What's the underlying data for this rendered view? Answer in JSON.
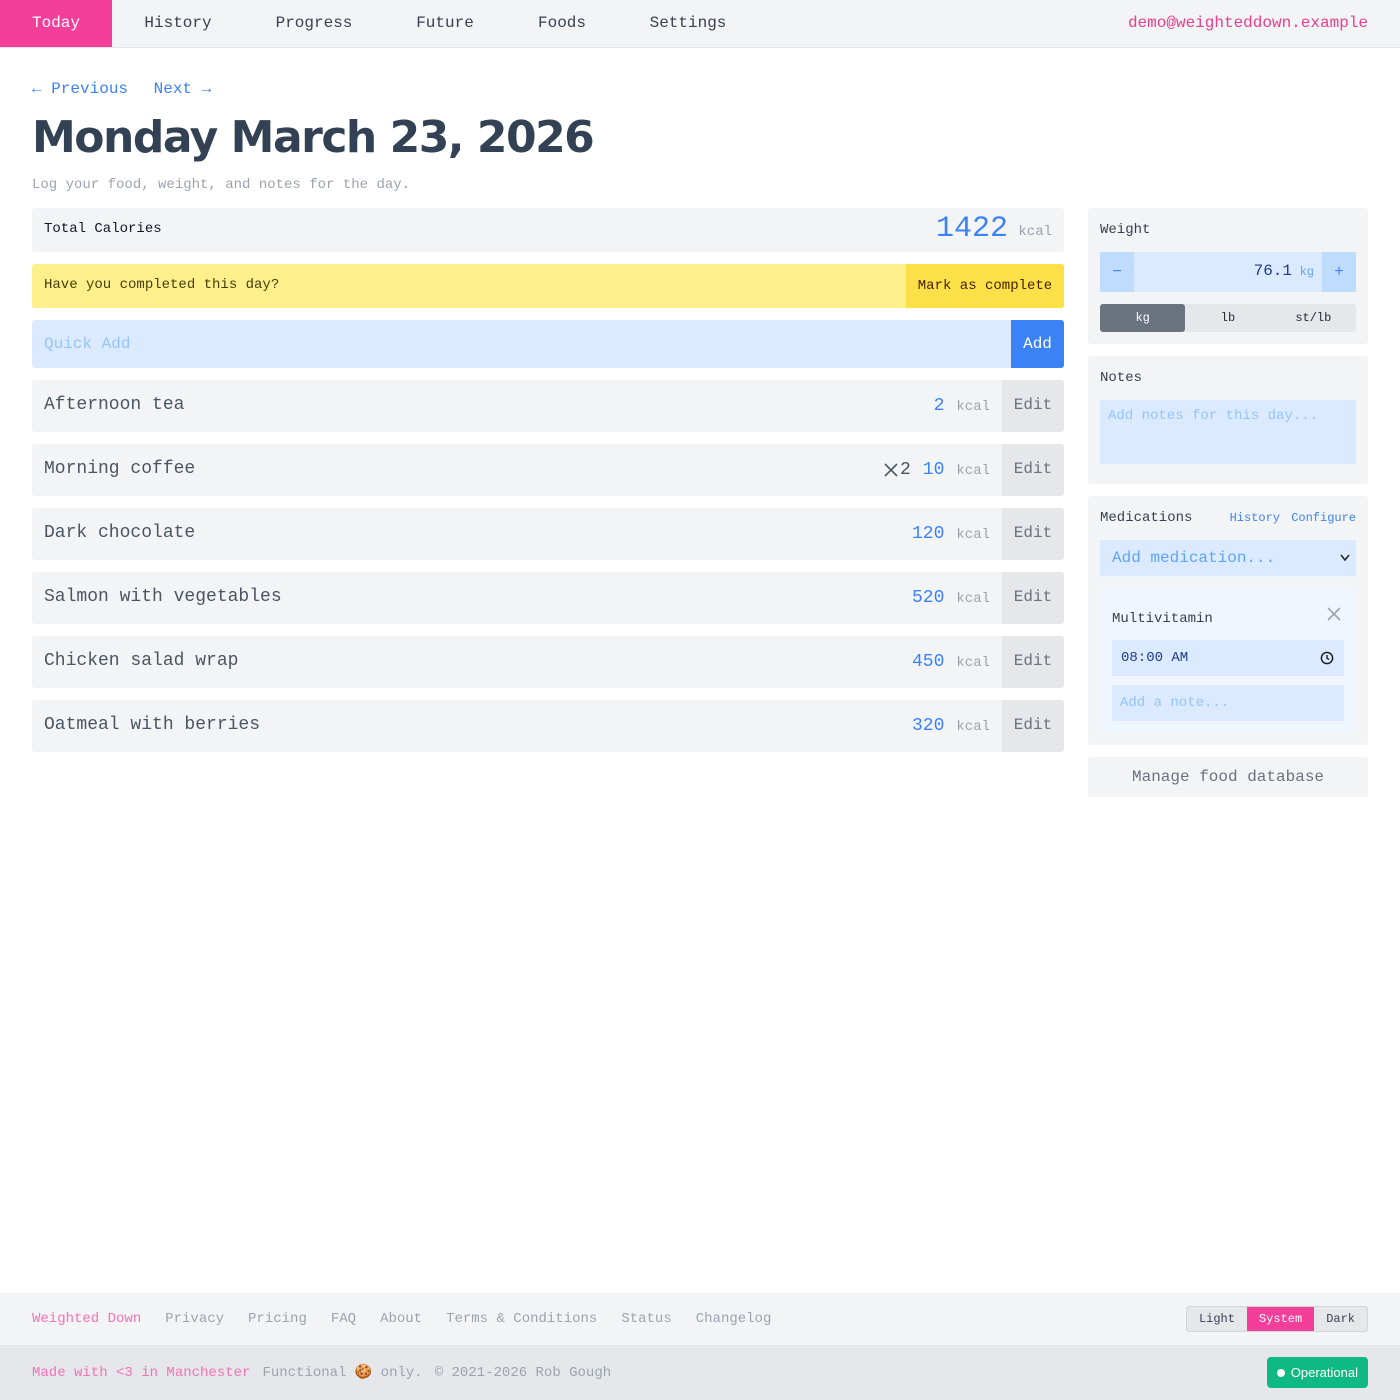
{
  "nav": {
    "tabs": [
      "Today",
      "History",
      "Progress",
      "Future",
      "Foods",
      "Settings"
    ],
    "active_tab": "Today",
    "user_email": "demo@weighteddown.example"
  },
  "day_nav": {
    "previous": "← Previous",
    "next": "Next →"
  },
  "header": {
    "title": "Monday March 23, 2026",
    "subtitle": "Log your food, weight, and notes for the day."
  },
  "total": {
    "label": "Total Calories",
    "value": "1422",
    "unit": "kcal"
  },
  "complete_banner": {
    "question": "Have you completed this day?",
    "button": "Mark as complete"
  },
  "quick_add": {
    "placeholder": "Quick Add",
    "button": "Add"
  },
  "foods": [
    {
      "name": "Afternoon tea",
      "multiplier": "",
      "kcal": "2",
      "unit": "kcal",
      "edit": "Edit"
    },
    {
      "name": "Morning coffee",
      "multiplier": "2",
      "kcal": "10",
      "unit": "kcal",
      "edit": "Edit"
    },
    {
      "name": "Dark chocolate",
      "multiplier": "",
      "kcal": "120",
      "unit": "kcal",
      "edit": "Edit"
    },
    {
      "name": "Salmon with vegetables",
      "multiplier": "",
      "kcal": "520",
      "unit": "kcal",
      "edit": "Edit"
    },
    {
      "name": "Chicken salad wrap",
      "multiplier": "",
      "kcal": "450",
      "unit": "kcal",
      "edit": "Edit"
    },
    {
      "name": "Oatmeal with berries",
      "multiplier": "",
      "kcal": "320",
      "unit": "kcal",
      "edit": "Edit"
    }
  ],
  "weight": {
    "title": "Weight",
    "value": "76.1",
    "unit": "kg",
    "decrement": "−",
    "increment": "+",
    "units": [
      "kg",
      "lb",
      "st/lb"
    ],
    "selected_unit": "kg"
  },
  "notes": {
    "title": "Notes",
    "placeholder": "Add notes for this day..."
  },
  "medications": {
    "title": "Medications",
    "history_link": "History",
    "configure_link": "Configure",
    "select_placeholder": "Add medication...",
    "items": [
      {
        "name": "Multivitamin",
        "time": "08:00 AM",
        "note_placeholder": "Add a note..."
      }
    ]
  },
  "manage_db_button": "Manage food database",
  "footer": {
    "brand": "Weighted Down",
    "links": [
      "Privacy",
      "Pricing",
      "FAQ",
      "About",
      "Terms & Conditions",
      "Status",
      "Changelog"
    ],
    "theme_options": [
      "Light",
      "System",
      "Dark"
    ],
    "selected_theme": "System",
    "made_with": "Made with <3 in Manchester",
    "cookie_note": "Functional 🍪 only.",
    "copyright": "© 2021-2026 Rob Gough",
    "status_label": "Operational"
  },
  "colors": {
    "accent_pink": "#f43f9a",
    "link_blue": "#3b82f6",
    "banner_yellow": "#fdf08a",
    "status_green": "#10b981"
  }
}
